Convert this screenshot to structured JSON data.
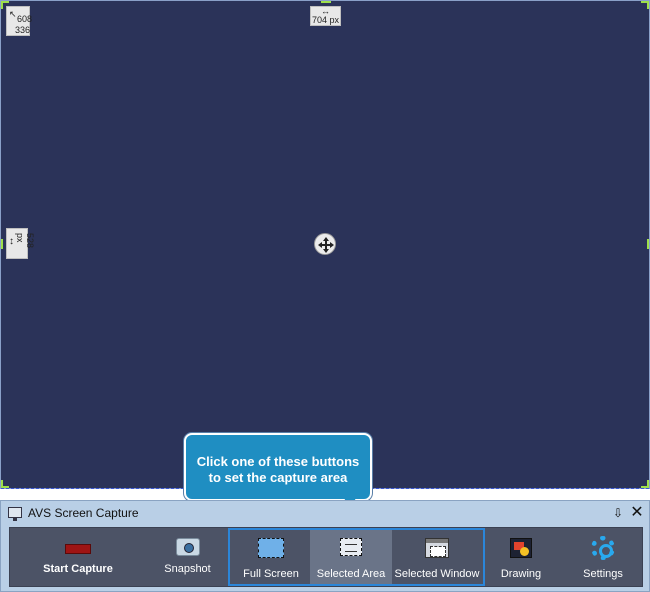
{
  "capture_area": {
    "position_x": "608",
    "position_y": "336",
    "width_label": "704 px",
    "height_label": "528 px",
    "background_color": "#2b3359"
  },
  "tooltip": {
    "line1": "Click one of these buttons",
    "line2": "to set the capture area"
  },
  "window": {
    "title": "AVS Screen Capture"
  },
  "toolbar": {
    "start_capture": "Start Capture",
    "snapshot": "Snapshot",
    "full_screen": "Full Screen",
    "selected_area": "Selected Area",
    "selected_window": "Selected Window",
    "drawing": "Drawing",
    "settings": "Settings",
    "selected": "Selected Area"
  },
  "colors": {
    "accent": "#2b86d9",
    "tooltip": "#1f8ec2",
    "toolbar": "#4c5366"
  }
}
